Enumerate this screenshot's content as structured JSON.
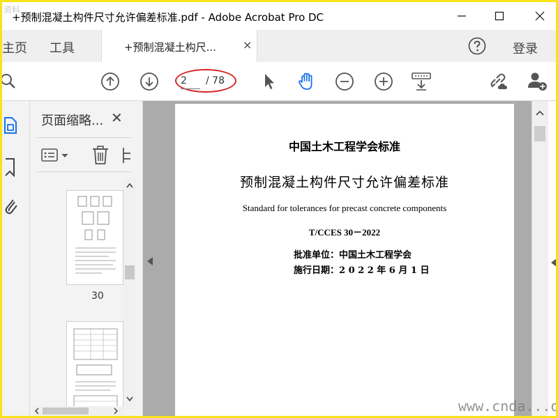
{
  "window": {
    "title": "+预制混凝土构件尺寸允许偏差标准.pdf - Adobe Acrobat Pro DC",
    "watermark_top": "资料"
  },
  "tabbar": {
    "home_label": "主页",
    "tools_label": "工具",
    "active_tab_label": "+预制混凝土构尺...",
    "close_glyph": "×",
    "login_label": "登录"
  },
  "toolbar": {
    "icons": [
      "search-icon",
      "previous-page-icon",
      "next-page-icon",
      "select-pointer-icon",
      "hand-tool-icon",
      "zoom-out-icon",
      "zoom-in-icon",
      "read-mode-icon",
      "share-link-icon",
      "add-user-icon"
    ],
    "page_current": "2",
    "page_total": "/ 78"
  },
  "sidebar": {
    "panel_title": "页面缩略...",
    "panel_close": "✕",
    "thumbnails": [
      {
        "label": "30"
      },
      {
        "label": ""
      }
    ]
  },
  "document": {
    "line1": "中国土木工程学会标准",
    "line2": "预制混凝土构件尺寸允许偏差标准",
    "line3": "Standard for tolerances for precast concrete components",
    "line4": "T/CCES 30－2022",
    "line5": "批准单位：中国土木工程学会",
    "line6": "施行日期：2 0 2 2 年 6 月 1 日"
  },
  "footer": {
    "watermark": "www.cnda...om"
  },
  "colors": {
    "highlight_ring": "#d42424",
    "hand_tool": "#1a73e8",
    "frame": "#f7e21b"
  }
}
